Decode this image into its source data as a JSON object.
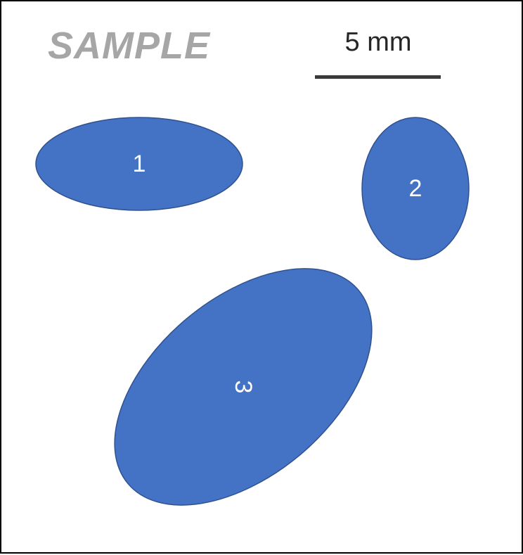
{
  "watermark": "SAMPLE",
  "scale_bar": {
    "label": "5 mm"
  },
  "colors": {
    "ellipse_fill": "#4472c4",
    "ellipse_stroke": "#2f528f",
    "watermark": "#a6a6a6",
    "scale_bar": "#3a3a3a"
  },
  "ellipses": [
    {
      "label": "1"
    },
    {
      "label": "2"
    },
    {
      "label": "3"
    }
  ]
}
